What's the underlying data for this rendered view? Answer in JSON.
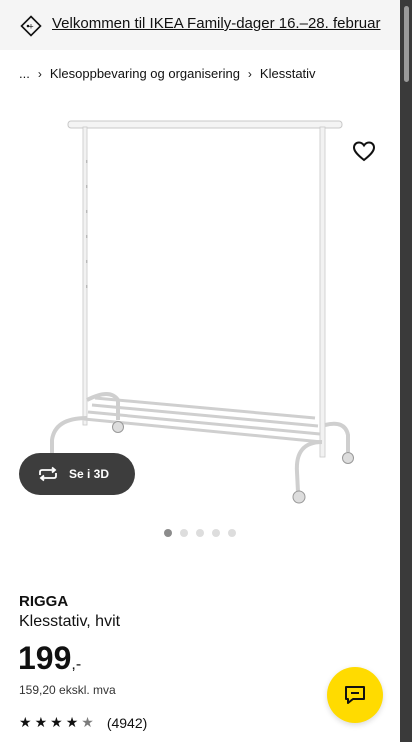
{
  "banner": {
    "text": "Velkommen til IKEA Family-dager 16.–28. februar",
    "icon": "tag-icon"
  },
  "breadcrumb": {
    "items": [
      "...",
      "Klesoppbevaring og organisering",
      "Klesstativ"
    ],
    "separator": "›"
  },
  "gallery": {
    "view_3d_label": "Se i 3D",
    "image_count": 5,
    "active_index": 0
  },
  "product": {
    "name": "RIGGA",
    "description": "Klesstativ, hvit",
    "price_integer": "199",
    "price_suffix": ",-",
    "price_ex_vat": "159,20 ekskl. mva",
    "rating_value": 4.5,
    "rating_count": "(4942)"
  },
  "colors": {
    "accent_yellow": "#ffdb00",
    "banner_bg": "#f5f5f5",
    "button_dark": "#3d3d3d"
  }
}
